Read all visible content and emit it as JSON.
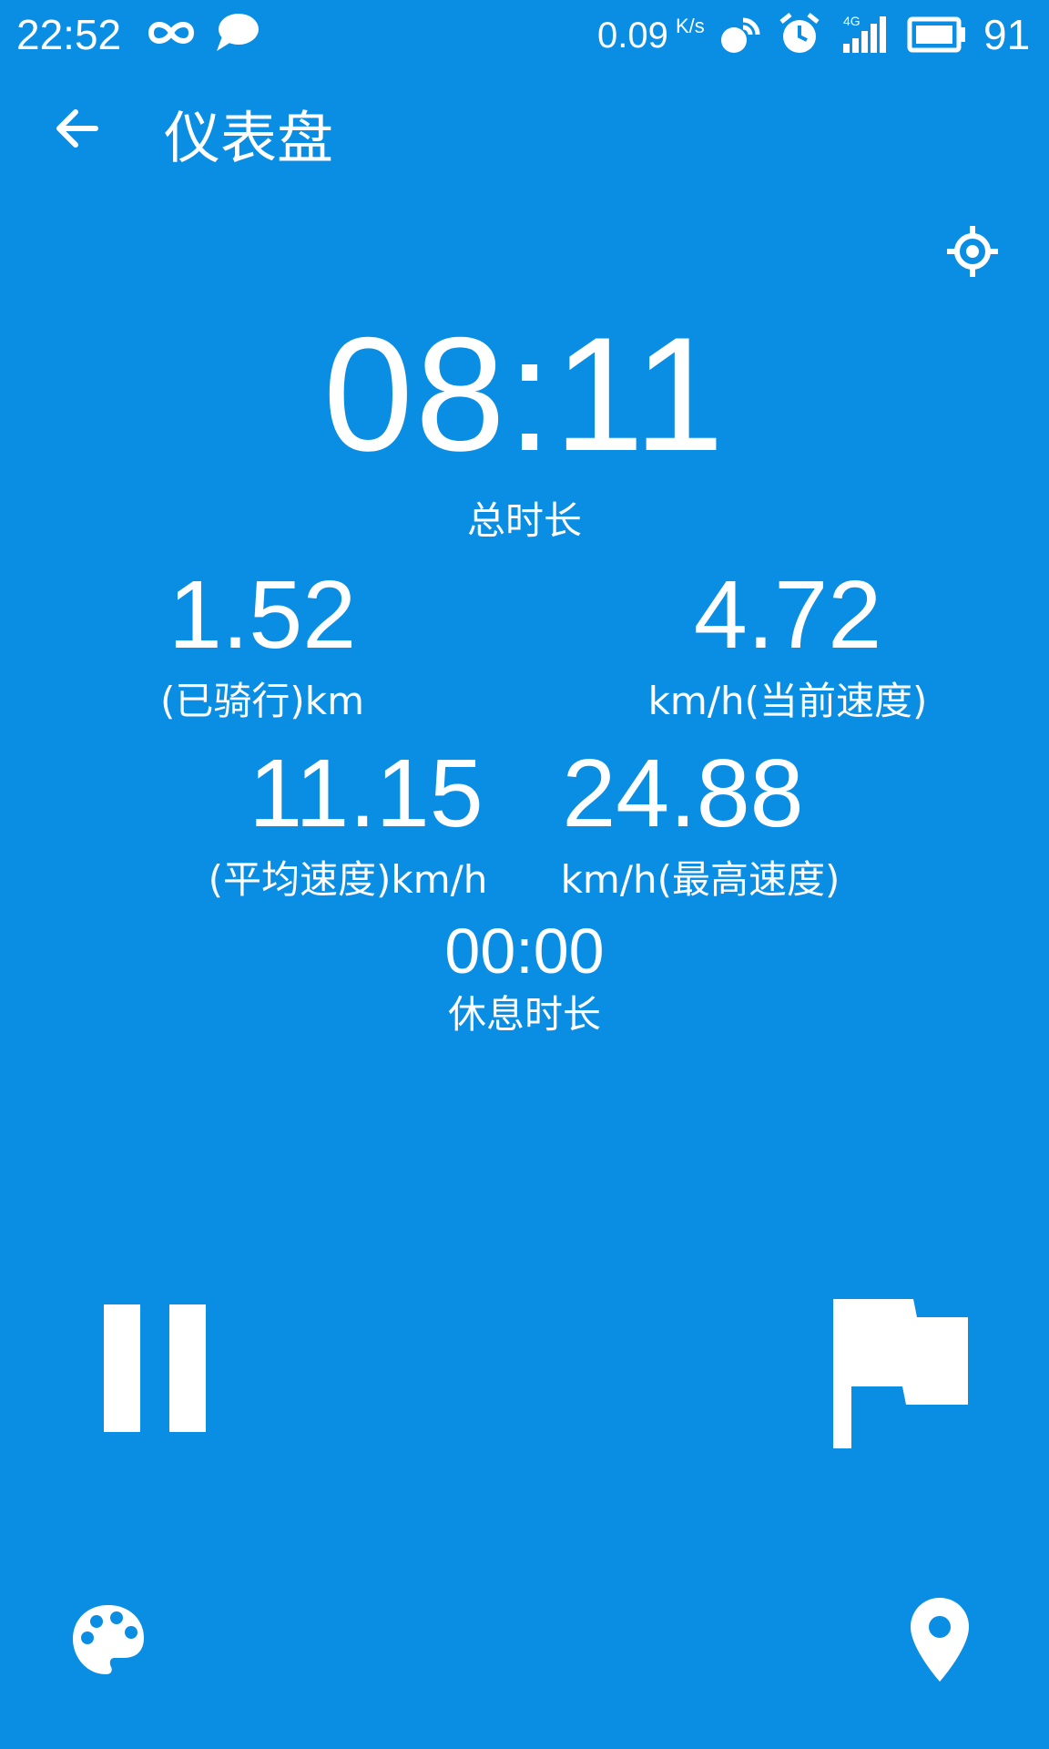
{
  "status_bar": {
    "time": "22:52",
    "net_speed": "0.09",
    "net_speed_unit": "K/s",
    "signal_type": "4G",
    "battery": "91",
    "icons": [
      "infinity-icon",
      "chat-bubble-icon",
      "hotspot-icon",
      "alarm-icon",
      "signal-icon",
      "battery-icon"
    ]
  },
  "header": {
    "back_icon": "arrow-left-icon",
    "title": "仪表盘",
    "locate_icon": "crosshair-icon"
  },
  "dashboard": {
    "total_time": {
      "value": "08:11",
      "label": "总时长"
    },
    "distance": {
      "value": "1.52",
      "label": "(已骑行)km"
    },
    "current_speed": {
      "value": "4.72",
      "label": "km/h(当前速度)"
    },
    "avg_speed": {
      "value": "11.15",
      "label": "(平均速度)km/h"
    },
    "max_speed": {
      "value": "24.88",
      "label": "km/h(最高速度)"
    },
    "rest_time": {
      "value": "00:00",
      "label": "休息时长"
    }
  },
  "controls": {
    "pause_icon": "pause-icon",
    "finish_icon": "flag-icon",
    "theme_icon": "palette-icon",
    "map_icon": "map-pin-icon"
  },
  "colors": {
    "background": "#0a8ee4",
    "foreground": "#ffffff"
  }
}
